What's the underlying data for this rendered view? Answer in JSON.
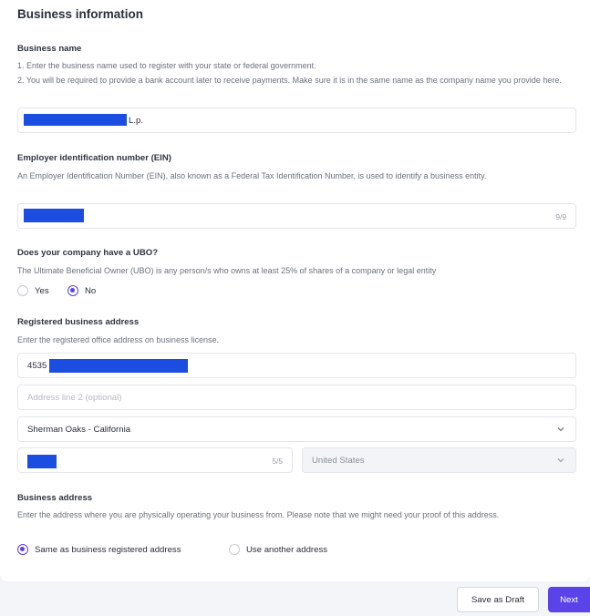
{
  "page": {
    "title": "Business information"
  },
  "business_name": {
    "label": "Business name",
    "help_1": "1. Enter the business name used to register with your state or federal government.",
    "help_2": "2. You will be required to provide a bank account later to receive payments. Make sure it is in the same name as the company name you provide here.",
    "value_suffix": "L.p."
  },
  "ein": {
    "label": "Employer identification number (EIN)",
    "help": "An Employer Identification Number (EIN), also known as a Federal Tax Identification Number, is used to identify a business entity.",
    "counter": "9/9"
  },
  "ubo": {
    "label": "Does your company have a UBO?",
    "help": "The Ultimate Beneficial Owner (UBO) is any person/s who owns at least 25% of shares of a company or legal entity",
    "options": [
      "Yes",
      "No"
    ],
    "selected": "No"
  },
  "registered_address": {
    "label": "Registered business address",
    "help": "Enter the registered office address on business license.",
    "line1_prefix": "4535",
    "line2_placeholder": "Address line 2 (optional)",
    "city_state": "Sherman Oaks - California",
    "zip_counter": "5/5",
    "country": "United States"
  },
  "business_address": {
    "label": "Business address",
    "help": "Enter the address where you are physically operating your business from. Please note that we might need your proof of this address.",
    "options": [
      "Same as business registered address",
      "Use another address"
    ],
    "selected": "Same as business registered address"
  },
  "footer": {
    "save_draft": "Save as Draft",
    "next": "Next"
  },
  "colors": {
    "accent": "#5a43e8",
    "redaction": "#1b4ee0"
  }
}
